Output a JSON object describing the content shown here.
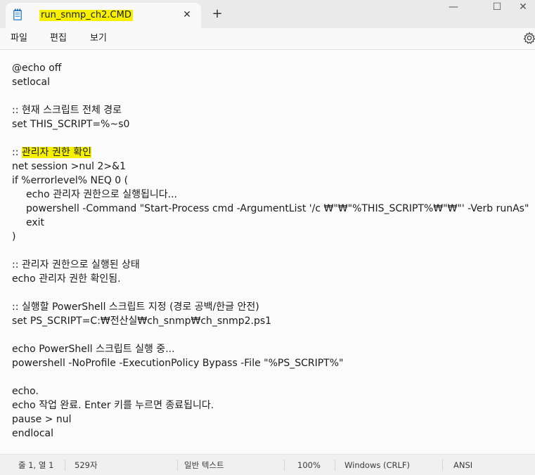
{
  "tab": {
    "title": "run_snmp_ch2.CMD",
    "close_glyph": "✕"
  },
  "new_tab_glyph": "+",
  "window_controls": {
    "minimize": "—",
    "maximize": "☐",
    "close": "✕"
  },
  "menu": {
    "file": "파일",
    "edit": "편집",
    "view": "보기"
  },
  "highlight_color": "#f6f000",
  "lines": [
    {
      "text": "@echo off"
    },
    {
      "text": "setlocal"
    },
    {
      "text": ""
    },
    {
      "text": ":: 현재 스크립트 전체 경로"
    },
    {
      "text": "set THIS_SCRIPT=%~s0"
    },
    {
      "text": ""
    },
    {
      "prefix": ":: ",
      "highlight": "관리자 권한 확인"
    },
    {
      "text": "net session >nul 2>&1"
    },
    {
      "text": "if %errorlevel% NEQ 0 ("
    },
    {
      "text": "echo 관리자 권한으로 실행됩니다...",
      "indent": true
    },
    {
      "text": "powershell -Command \"Start-Process cmd -ArgumentList '/c ₩\"₩\"%THIS_SCRIPT%₩\"₩\"' -Verb runAs\"",
      "indent": true
    },
    {
      "text": "exit",
      "indent": true
    },
    {
      "text": ")"
    },
    {
      "text": ""
    },
    {
      "text": ":: 관리자 권한으로 실행된 상태"
    },
    {
      "text": "echo 관리자 권한 확인됨."
    },
    {
      "text": ""
    },
    {
      "text": ":: 실행할 PowerShell 스크립트 지정 (경로 공백/한글 안전)"
    },
    {
      "text": "set PS_SCRIPT=C:₩전산실₩ch_snmp₩ch_snmp2.ps1"
    },
    {
      "text": ""
    },
    {
      "text": "echo PowerShell 스크립트 실행 중..."
    },
    {
      "text": "powershell -NoProfile -ExecutionPolicy Bypass -File \"%PS_SCRIPT%\""
    },
    {
      "text": ""
    },
    {
      "text": "echo."
    },
    {
      "text": "echo 작업 완료. Enter 키를 누르면 종료됩니다."
    },
    {
      "text": "pause > nul"
    },
    {
      "text": "endlocal"
    }
  ],
  "status": {
    "position": "줄 1, 열 1",
    "chars": "529자",
    "format": "일반 텍스트",
    "zoom": "100%",
    "line_ending": "Windows (CRLF)",
    "encoding": "ANSI"
  }
}
